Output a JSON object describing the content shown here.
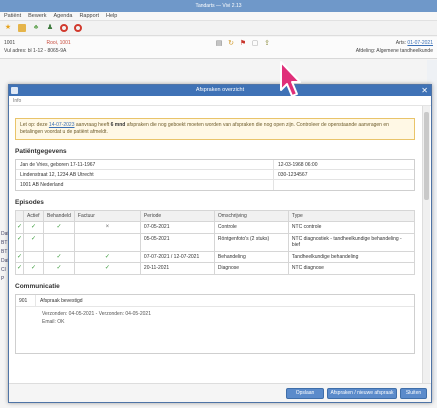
{
  "app": {
    "title": "Tandarts — Vivi 2.13",
    "menu": [
      "Patiënt",
      "Bewerk",
      "Agenda",
      "Rapport",
      "Help"
    ],
    "info": {
      "line1_left": "1001",
      "line1_red": "Rooi, 1001",
      "line2_left": "Vul adres: bl 1-12 - 8065-9A",
      "line1_right_prefix": "Arts:",
      "line1_right_link": "01-07-2021",
      "line2_right": "Afdeling: Algemene tandheelkunde"
    },
    "left_strip": [
      "Dat",
      "BT",
      "BT",
      "Dat",
      "Cl",
      "P"
    ]
  },
  "dialog": {
    "title": "Afspraken overzicht",
    "subtitle": "Info",
    "warning": {
      "text_a": "Let op: deze",
      "link": "14-07-2023",
      "text_b": "aanvraag heeft",
      "bold": "6 mnd",
      "text_c": "afspraken die nog geboekt moeten worden van afspraken die nog open zijn. Controleer de",
      "text_d": "openstaande aanvragen en betalingen voordat u de patiënt afmeldt."
    },
    "personal": {
      "heading": "Patiëntgegevens",
      "rows": [
        [
          "Jan de Vries, geboren 17-11-1967",
          "12-03-1968 06:00"
        ],
        [
          "Lindenstraat 12, 1234 AB Utrecht",
          "030-1234567"
        ],
        [
          "1001 AB Nederland",
          ""
        ]
      ]
    },
    "episodes": {
      "heading": "Episodes",
      "columns": [
        "Actief",
        "Behandeld",
        "Factuur",
        "Periode",
        "Omschrijving",
        "Type"
      ],
      "rows": [
        {
          "actief": "✓",
          "behandeld": "✓",
          "factuur": "×",
          "periode": "07-05-2021",
          "omschrijving": "Controle",
          "type": "NTC controle"
        },
        {
          "actief": "✓",
          "behandeld": "",
          "factuur": "",
          "periode": "05-05-2021",
          "omschrijving": "Röntgenfoto's (2 stuks)",
          "type": "NTC diagnostiek - tandheelkundige behandeling - bief"
        },
        {
          "actief": "",
          "behandeld": "✓",
          "factuur": "✓",
          "periode": "07-07-2021 / 12-07-2021",
          "omschrijving": "Behandeling",
          "type": "Tandheelkundige behandeling"
        },
        {
          "actief": "✓",
          "behandeld": "✓",
          "factuur": "✓",
          "periode": "20-11-2021",
          "omschrijving": "Diagnose",
          "type": "NTC diagnose"
        }
      ]
    },
    "communication": {
      "heading": "Communicatie",
      "row_num": "901",
      "row_title": "Afspraak bevestigd",
      "detail_line1": "Verzonden: 04-05-2021 - Verzonden: 04-05-2021",
      "detail_line2": "Email: OK"
    },
    "buttons": {
      "primary": "Opslaan",
      "secondary": "Afspraken / nieuwe afspraak",
      "close": "Sluiten"
    }
  },
  "colors": {
    "dialog_title": "#3f72b6",
    "app_title": "#6f98c9",
    "check_green": "#3a9a3a",
    "warning_border": "#e9c46a",
    "cursor": "#e0307a"
  }
}
